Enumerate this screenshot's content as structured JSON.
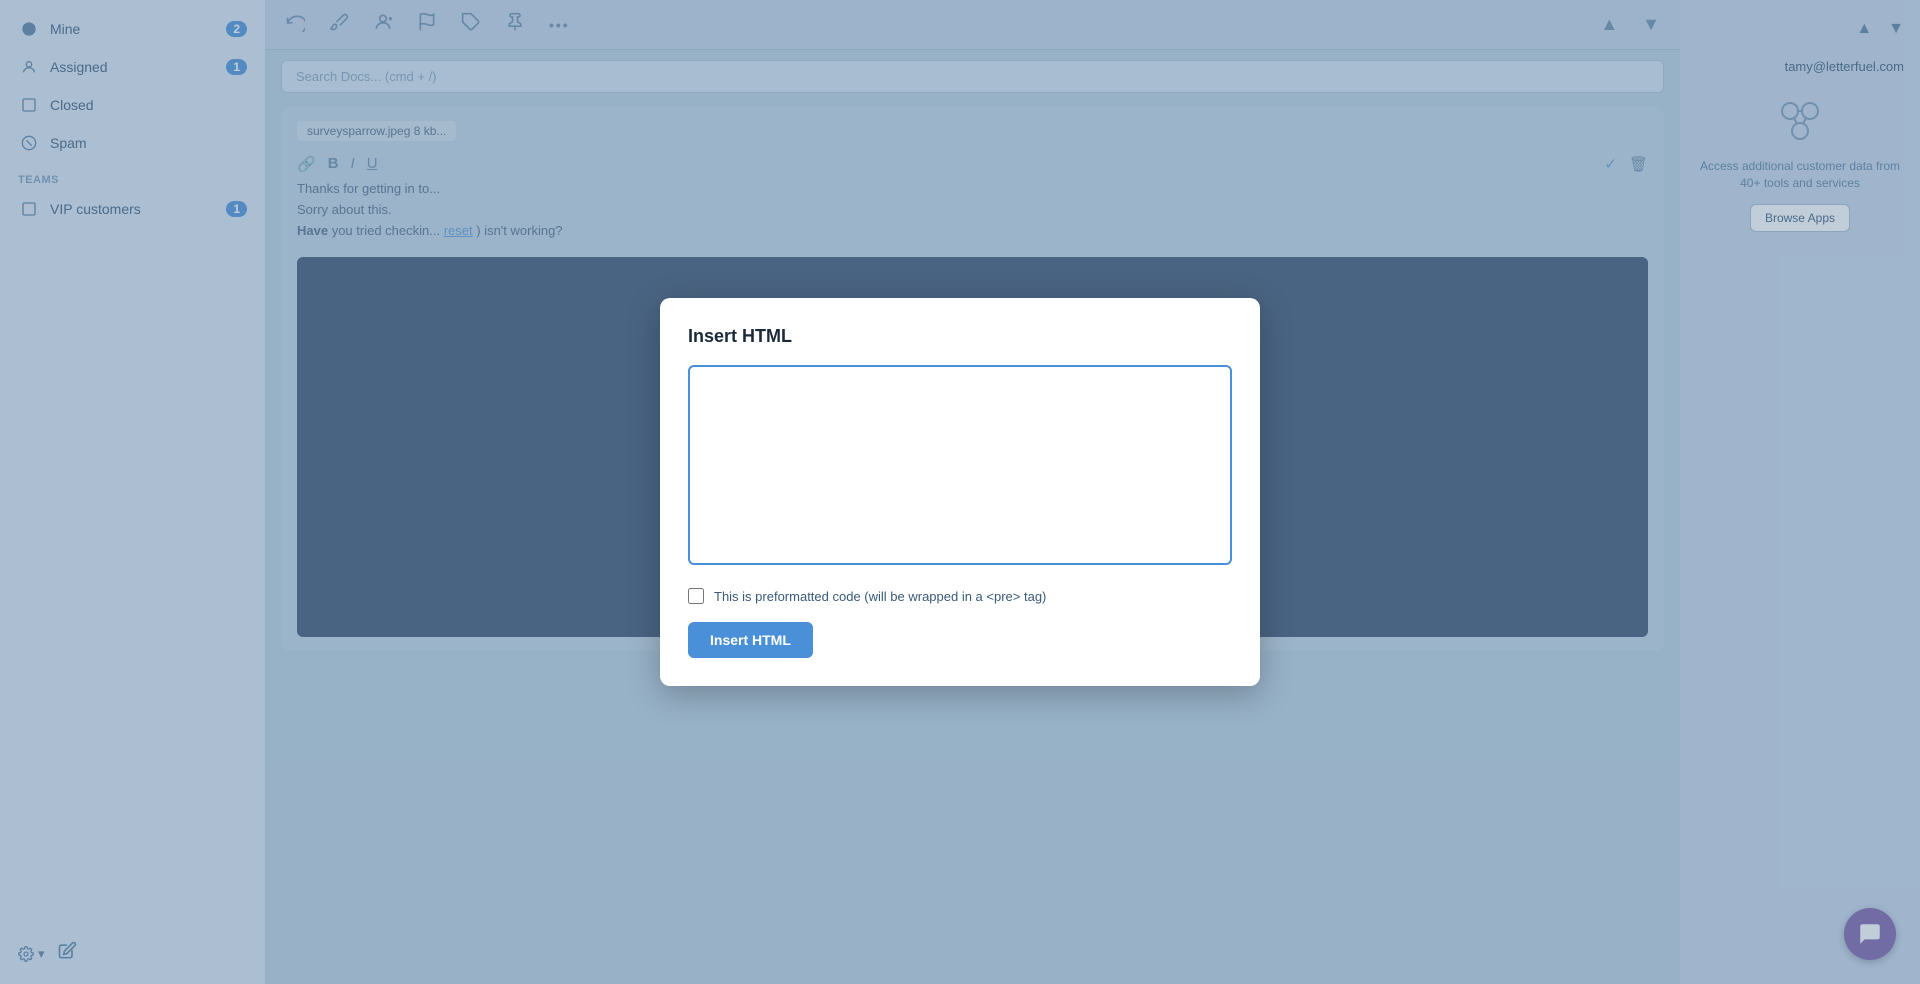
{
  "sidebar": {
    "items": [
      {
        "id": "mine",
        "label": "Mine",
        "badge": "2",
        "icon": "home"
      },
      {
        "id": "assigned",
        "label": "Assigned",
        "badge": "1",
        "icon": "person"
      },
      {
        "id": "closed",
        "label": "Closed",
        "badge": "",
        "icon": "box"
      },
      {
        "id": "spam",
        "label": "Spam",
        "badge": "",
        "icon": "block"
      }
    ],
    "teams_section": "TEAMS",
    "team_items": [
      {
        "id": "vip",
        "label": "VIP customers",
        "badge": "1"
      }
    ],
    "gear_label": "⚙",
    "compose_label": "✎"
  },
  "toolbar": {
    "undo_icon": "↩",
    "brush_icon": "🖌",
    "person_icon": "👤",
    "flag_icon": "⚑",
    "tag_icon": "🏷",
    "pin_icon": "📌",
    "more_icon": "•••",
    "up_icon": "▲",
    "down_icon": "▼"
  },
  "search": {
    "placeholder": "Search Docs... (cmd + /)"
  },
  "email": {
    "attachment": "surveysparrow.jpeg 8 kb...",
    "format_bold": "B",
    "format_italic": "I",
    "format_underline": "U",
    "body_line1": "Thanks for getting in to...",
    "body_line2": "Sorry about this.",
    "body_line3_start": "Have",
    "body_line3_mid": " you tried checkin...",
    "body_link": "reset",
    "body_line3_end": ") isn't working?"
  },
  "right_panel": {
    "email_display": "tamy@letterfuel.com",
    "apps_text": "Access additional customer data from 40+ tools and services",
    "browse_btn": "Browse Apps"
  },
  "modal": {
    "title": "Insert HTML",
    "textarea_value": "",
    "checkbox_label": "This is preformatted code (will be wrapped in a <pre> tag)",
    "insert_btn": "Insert HTML"
  },
  "chat_fab_icon": "💬"
}
